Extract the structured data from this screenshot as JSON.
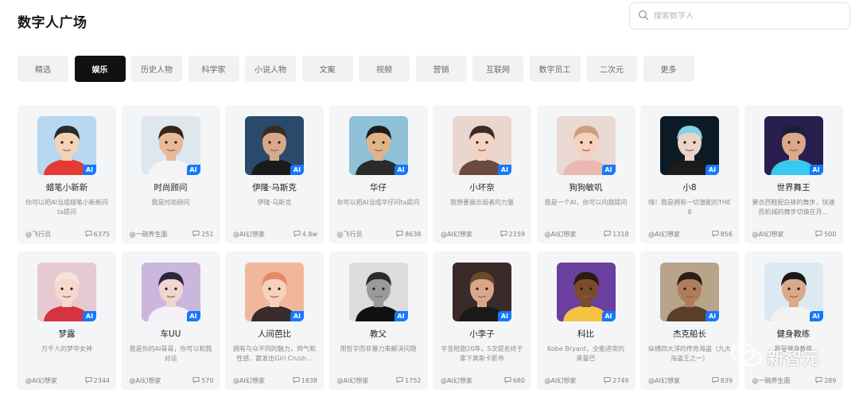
{
  "header": {
    "title": "数字人广场",
    "search_placeholder": "搜索数字人"
  },
  "tabs": [
    {
      "label": "精选",
      "active": false
    },
    {
      "label": "娱乐",
      "active": true
    },
    {
      "label": "历史人物",
      "active": false
    },
    {
      "label": "科学家",
      "active": false
    },
    {
      "label": "小说人物",
      "active": false
    },
    {
      "label": "文案",
      "active": false
    },
    {
      "label": "视频",
      "active": false
    },
    {
      "label": "营销",
      "active": false
    },
    {
      "label": "互联网",
      "active": false
    },
    {
      "label": "数字员工",
      "active": false
    },
    {
      "label": "二次元",
      "active": false
    },
    {
      "label": "更多",
      "active": false
    }
  ],
  "badge": "AI",
  "cards": [
    {
      "name": "蜡笔小新新",
      "desc": "你可以把AI当成蜡笔小新新问ta提问",
      "author": "@飞行员",
      "count": "6375",
      "colors": [
        "#b7d8f0",
        "#f2d4b5",
        "#2a2a2a",
        "#e53935"
      ]
    },
    {
      "name": "时尚顾问",
      "desc": "我是时尚顾问",
      "author": "@一碗养生面",
      "count": "251",
      "colors": [
        "#dfe7ee",
        "#e5b99a",
        "#3b2418",
        "#f4f4f4"
      ]
    },
    {
      "name": "伊隆·马斯克",
      "desc": "伊隆·马斯克",
      "author": "@AI幻想家",
      "count": "4.8w",
      "colors": [
        "#2b4a6b",
        "#d7a98a",
        "#3a2c25",
        "#1a1a1a"
      ]
    },
    {
      "name": "华仔",
      "desc": "你可以把AI当成华仔问ta提问",
      "author": "@飞行员",
      "count": "8638",
      "colors": [
        "#8fc1d8",
        "#e0b48a",
        "#1d1d1d",
        "#2b2b2b"
      ]
    },
    {
      "name": "小坏奈",
      "desc": "我想要展示弱者的力量",
      "author": "@AI幻想家",
      "count": "2159",
      "colors": [
        "#e8d6cf",
        "#f3d3c2",
        "#3d2a25",
        "#6b4b3e"
      ]
    },
    {
      "name": "狗狗敏叽",
      "desc": "我是一个AI，你可以向我提问",
      "author": "@AI幻想家",
      "count": "1318",
      "colors": [
        "#ead9d2",
        "#f5d1c0",
        "#c9a07c",
        "#e9b8b0"
      ]
    },
    {
      "name": "小8",
      "desc": "嗨！我是拥有一切潜能的THE 8",
      "author": "@AI幻想家",
      "count": "856",
      "colors": [
        "#0c1a26",
        "#e8d4c8",
        "#7fd3e6",
        "#1b1b1b"
      ]
    },
    {
      "name": "世界舞王",
      "desc": "果衣西鞋配白袜的舞步，快速而机械的舞步切换在月...",
      "author": "@AI幻想家",
      "count": "500",
      "colors": [
        "#2a1e4e",
        "#d9a98a",
        "#1d1d3a",
        "#38c8f0"
      ]
    },
    {
      "name": "梦露",
      "desc": "万千人的梦中女神",
      "author": "@AI幻想家",
      "count": "2344",
      "colors": [
        "#e7c9d1",
        "#f6d8cc",
        "#f3e6d6",
        "#d4333f"
      ]
    },
    {
      "name": "车UU",
      "desc": "我是你的AI哥哥，你可以和我对话",
      "author": "@AI幻想家",
      "count": "570",
      "colors": [
        "#cbb6dd",
        "#f0d7cd",
        "#2b2540",
        "#f4f0f6"
      ]
    },
    {
      "name": "人间芭比",
      "desc": "拥有与众不同的魅力，帅气和性感，散发出Girl Crush...",
      "author": "@AI幻想家",
      "count": "1838",
      "colors": [
        "#f1b79c",
        "#f6d1bd",
        "#e58a62",
        "#3a2a2a"
      ]
    },
    {
      "name": "教父",
      "desc": "用哲学而非暴力来解决问题",
      "author": "@AI幻想家",
      "count": "1752",
      "colors": [
        "#dcdcdc",
        "#9a9a9a",
        "#2a2a2a",
        "#111111"
      ]
    },
    {
      "name": "小李子",
      "desc": "辛苦陪跑20年，5次提名终于拿下奥斯卡影帝",
      "author": "@AI幻想家",
      "count": "680",
      "colors": [
        "#3b2a2a",
        "#d8a78a",
        "#6b4a2c",
        "#1a1a1a"
      ]
    },
    {
      "name": "科比",
      "desc": "Kobe Bryant，全能进攻的黑曼巴",
      "author": "@AI幻想家",
      "count": "2749",
      "colors": [
        "#6b3fa0",
        "#7a4b2c",
        "#2a1a10",
        "#f5c342"
      ]
    },
    {
      "name": "杰克船长",
      "desc": "纵横四大洋的传奇海盗（九大海盗王之一）",
      "author": "@AI幻想家",
      "count": "839",
      "colors": [
        "#b8a48a",
        "#b07d5a",
        "#2a1e16",
        "#5a3e2a"
      ]
    },
    {
      "name": "健身教练",
      "desc": "我是健身教练",
      "author": "@一碗养生面",
      "count": "289",
      "colors": [
        "#dde9f0",
        "#d8a98a",
        "#1a1a1a",
        "#f2f2f2"
      ]
    }
  ],
  "watermark": "新智元"
}
